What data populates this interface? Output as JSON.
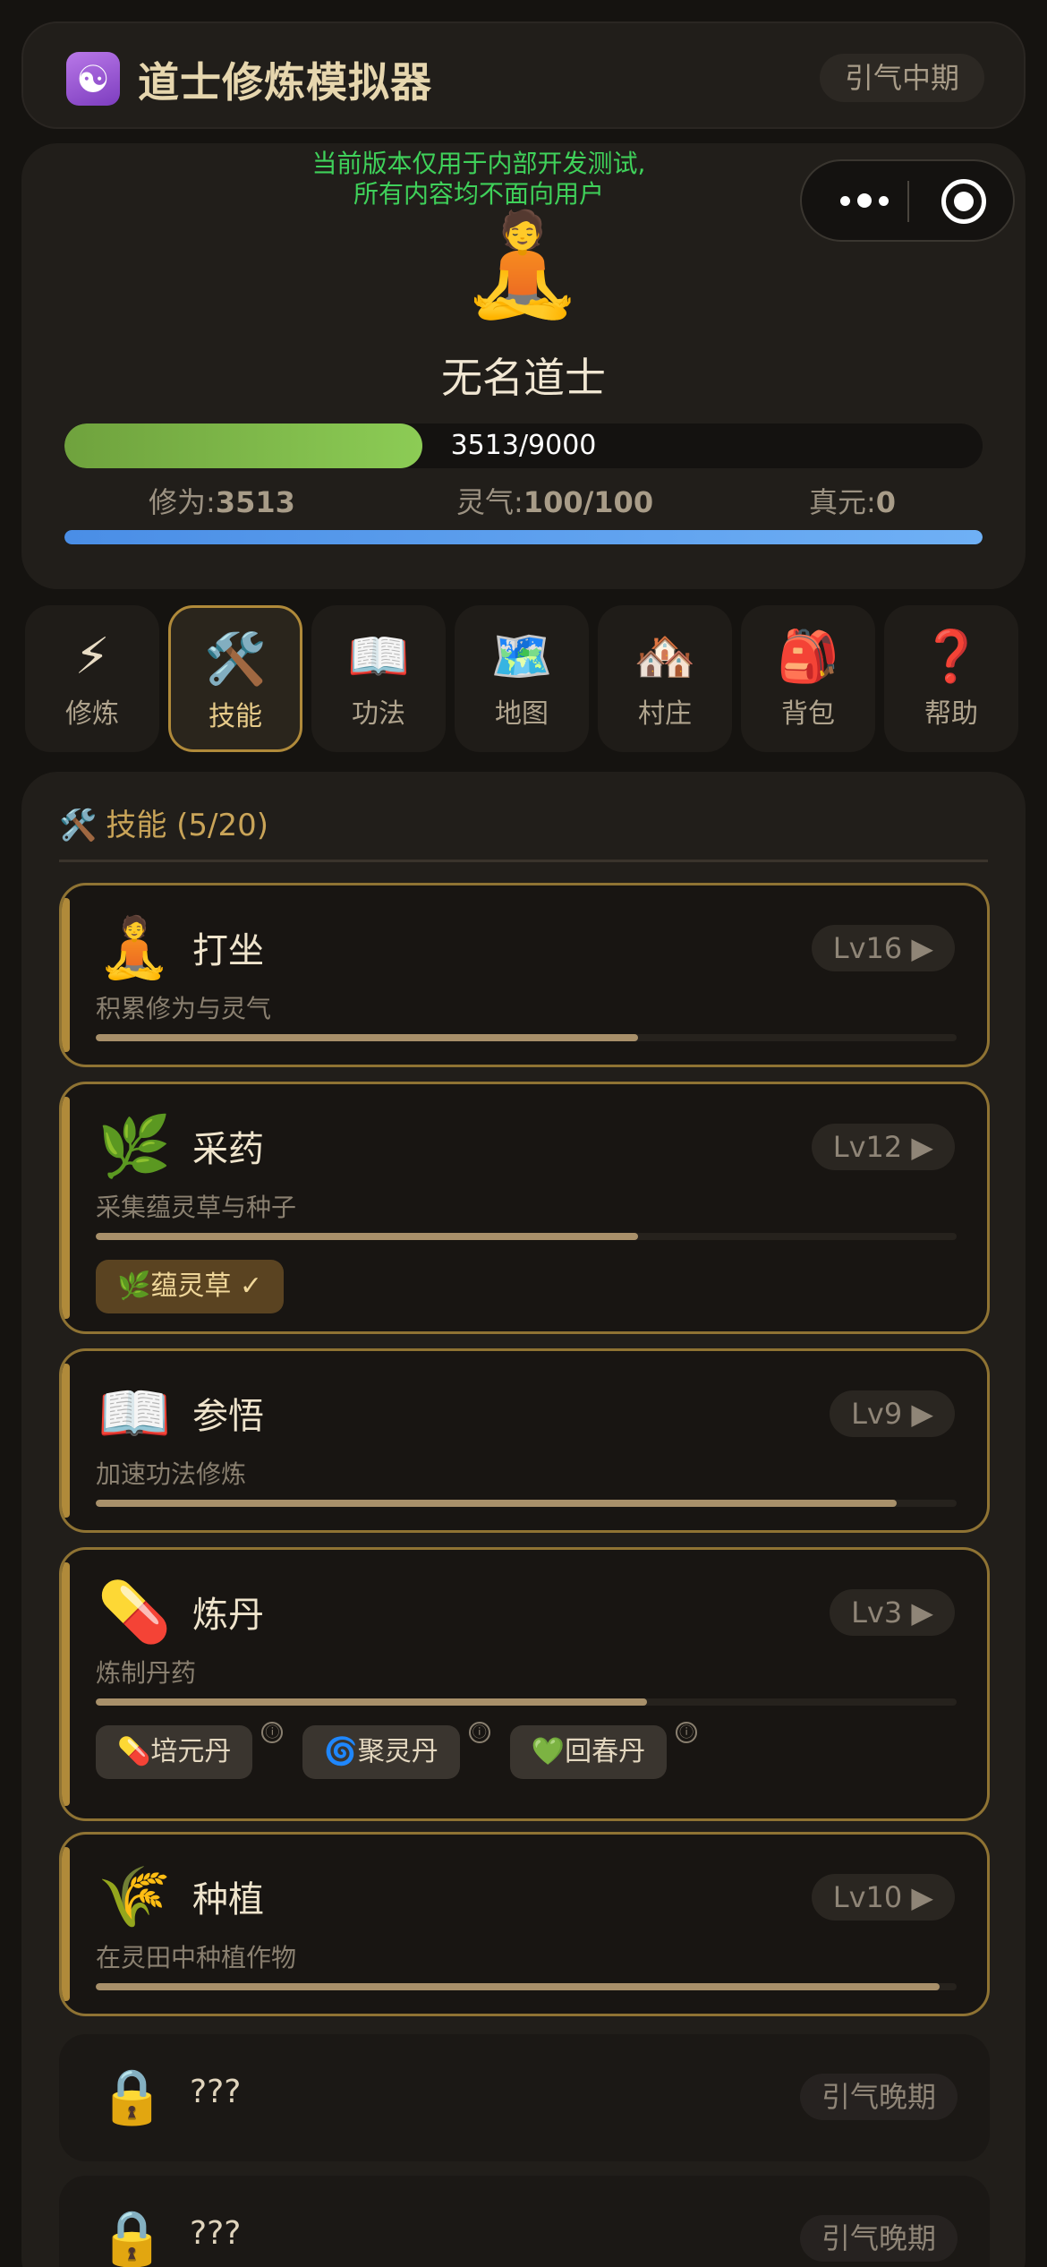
{
  "header": {
    "logo_icon": "yin-yang-icon",
    "logo_glyph": "☯",
    "title": "道士修炼模拟器",
    "realm_badge": "引气中期"
  },
  "profile": {
    "notice_line1": "当前版本仅用于内部开发测试,",
    "notice_line2": "所有内容均不面向用户",
    "avatar_glyph": "🧘",
    "name": "无名道士",
    "exp_current": 3513,
    "exp_max": 9000,
    "exp_text": "3513/9000",
    "stats": {
      "xiuwei_label": "修为:",
      "xiuwei_value": "3513",
      "lingqi_label": "灵气:",
      "lingqi_value": "100/100",
      "zhenyuan_label": "真元:",
      "zhenyuan_value": "0"
    },
    "mana_fraction": 1.0
  },
  "nav": {
    "tabs": [
      {
        "icon": "lightning-icon",
        "glyph": "⚡",
        "label": "修炼",
        "active": false
      },
      {
        "icon": "tools-icon",
        "glyph": "🛠️",
        "label": "技能",
        "active": true
      },
      {
        "icon": "book-icon",
        "glyph": "📖",
        "label": "功法",
        "active": false
      },
      {
        "icon": "map-icon",
        "glyph": "🗺️",
        "label": "地图",
        "active": false
      },
      {
        "icon": "village-icon",
        "glyph": "🏘️",
        "label": "村庄",
        "active": false
      },
      {
        "icon": "backpack-icon",
        "glyph": "🎒",
        "label": "背包",
        "active": false
      },
      {
        "icon": "question-icon",
        "glyph": "❓",
        "label": "帮助",
        "active": false
      }
    ]
  },
  "skills": {
    "header_glyph": "🛠️",
    "header": "技能 (5/20)",
    "items": [
      {
        "glyph": "🧘",
        "icon": "meditation-icon",
        "name": "打坐",
        "level": "Lv16 ▶",
        "desc": "积累修为与灵气",
        "progress": 0.63
      },
      {
        "glyph": "🌿",
        "icon": "herb-icon",
        "name": "采药",
        "level": "Lv12 ▶",
        "desc": "采集蕴灵草与种子",
        "progress": 0.63,
        "chips": [
          {
            "glyph": "🌿",
            "label": "蕴灵草 ✓",
            "unlocked": true
          }
        ]
      },
      {
        "glyph": "📖",
        "icon": "book-icon",
        "name": "参悟",
        "level": "Lv9 ▶",
        "desc": "加速功法修炼",
        "progress": 0.93
      },
      {
        "glyph": "💊",
        "icon": "pill-icon",
        "name": "炼丹",
        "level": "Lv3 ▶",
        "desc": "炼制丹药",
        "progress": 0.64,
        "chips": [
          {
            "glyph": "💊",
            "label": "培元丹",
            "unlocked": false,
            "info": "ⓘ"
          },
          {
            "glyph": "🌀",
            "label": "聚灵丹",
            "unlocked": false,
            "info": "ⓘ"
          },
          {
            "glyph": "💚",
            "label": "回春丹",
            "unlocked": false,
            "info": "ⓘ"
          }
        ]
      },
      {
        "glyph": "🌾",
        "icon": "rice-icon",
        "name": "种植",
        "level": "Lv10 ▶",
        "desc": "在灵田中种植作物",
        "progress": 0.98
      }
    ],
    "locked": [
      {
        "glyph": "🔒",
        "icon": "lock-icon",
        "name": "???",
        "requirement": "引气晚期"
      },
      {
        "glyph": "🔒",
        "icon": "lock-icon",
        "name": "???",
        "requirement": "引气晚期"
      }
    ]
  },
  "colors": {
    "accent": "#b08a3a",
    "exp_bar": "#8ccc55",
    "mana_bar": "#5a9fef",
    "notice": "#3fd15a"
  }
}
